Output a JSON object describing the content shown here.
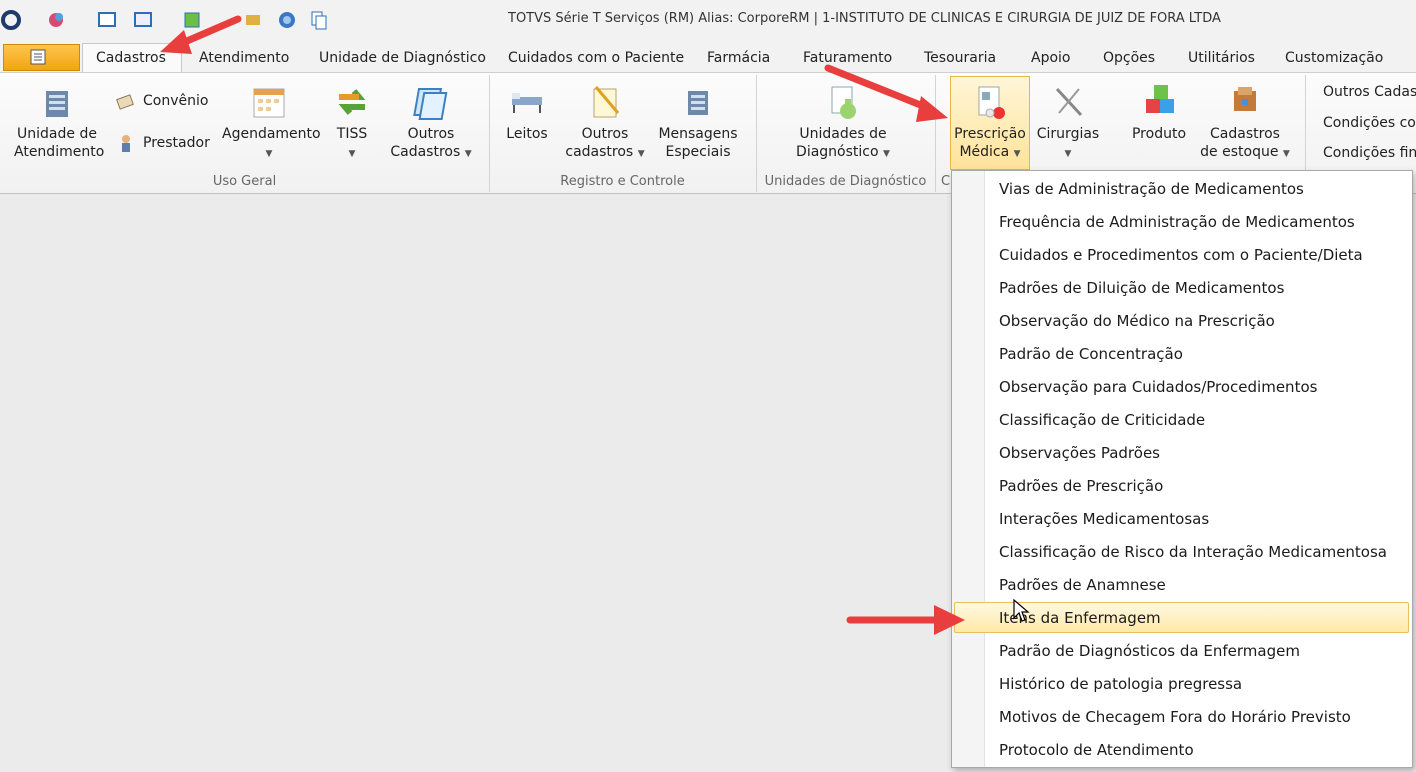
{
  "window": {
    "title": "TOTVS Série T Serviços (RM) Alias: CorporeRM | 1-INSTITUTO DE CLINICAS E CIRURGIA DE JUIZ DE FORA LTDA"
  },
  "tabs": [
    "Cadastros",
    "Atendimento",
    "Unidade de Diagnóstico",
    "Cuidados com o Paciente",
    "Farmácia",
    "Faturamento",
    "Tesouraria",
    "Apoio",
    "Opções",
    "Utilitários",
    "Customização"
  ],
  "ribbon": {
    "uso_geral": {
      "label": "Uso Geral",
      "unidade": [
        "Unidade de",
        "Atendimento"
      ],
      "convenio": "Convênio",
      "prestador": "Prestador",
      "agendamento": "Agendamento",
      "tiss": "TISS",
      "outros": [
        "Outros",
        "Cadastros"
      ]
    },
    "registro": {
      "label": "Registro e Controle",
      "leitos": "Leitos",
      "outros": [
        "Outros",
        "cadastros"
      ],
      "mensagens": [
        "Mensagens",
        "Especiais"
      ]
    },
    "unidades_diag": {
      "label": "Unidades de Diagnóstico",
      "btn": [
        "Unidades de",
        "Diagnóstico"
      ]
    },
    "prescricao": [
      "Prescrição",
      "Médica"
    ],
    "cirurgias": "Cirurgias",
    "produto": "Produto",
    "cadastros_estoque": [
      "Cadastros",
      "de estoque"
    ],
    "group_c_label": "C",
    "right": [
      "Outros Cadast",
      "Condições con",
      "Condições fina"
    ]
  },
  "menu": [
    "Vias de Administração de Medicamentos",
    "Frequência de Administração de Medicamentos",
    "Cuidados e Procedimentos com o Paciente/Dieta",
    "Padrões de Diluição de Medicamentos",
    "Observação do Médico na Prescrição",
    "Padrão de Concentração",
    "Observação para Cuidados/Procedimentos",
    "Classificação de Criticidade",
    "Observações Padrões",
    "Padrões de Prescrição",
    "Interações Medicamentosas",
    "Classificação de Risco da Interação Medicamentosa",
    "Padrões de Anamnese",
    "Itens da Enfermagem",
    "Padrão de Diagnósticos da Enfermagem",
    "Histórico de patologia pregressa",
    "Motivos de Checagem Fora do Horário Previsto",
    "Protocolo de Atendimento"
  ],
  "colors": {
    "accent_orange": "#f1a512",
    "highlight": "#ffe9a6",
    "annotation_arrow": "#e83e3e"
  }
}
